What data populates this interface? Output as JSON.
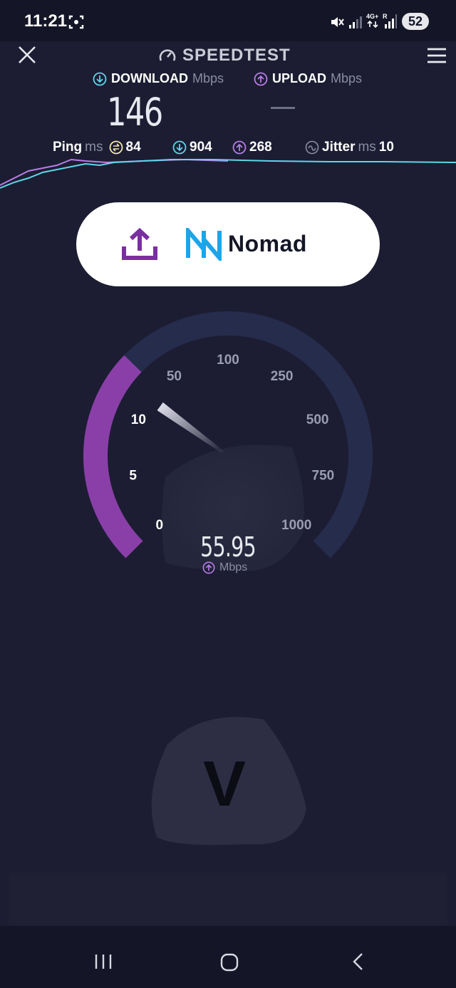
{
  "status_bar": {
    "time": "11:21",
    "battery": "52",
    "icons": [
      "screenshot-icon",
      "mute-icon",
      "signal-icon",
      "4g-plus-icon",
      "roaming-signal-icon",
      "battery-icon"
    ]
  },
  "app": {
    "title": "SPEEDTEST"
  },
  "download": {
    "label": "DOWNLOAD",
    "unit": "Mbps",
    "value": "146"
  },
  "upload": {
    "label": "UPLOAD",
    "unit": "Mbps",
    "value": "—"
  },
  "ping": {
    "label": "Ping",
    "unit": "ms",
    "idle": "84",
    "download": "904",
    "upload": "268"
  },
  "jitter": {
    "label": "Jitter",
    "unit": "ms",
    "value": "10"
  },
  "ad": {
    "brand": "Nomad"
  },
  "gauge": {
    "ticks": [
      "0",
      "5",
      "10",
      "50",
      "100",
      "250",
      "500",
      "750",
      "1000"
    ],
    "current_value": "55.95",
    "unit": "Mbps",
    "progress_fraction": 0.33,
    "colors": {
      "progress": "#8a3fa8",
      "track": "#262c4c",
      "needle": "#dcdcf0"
    }
  },
  "vpn": {
    "letter": "V"
  },
  "colors": {
    "background": "#1c1d32",
    "download_accent": "#5ed6e8",
    "upload_accent": "#b77de6"
  }
}
